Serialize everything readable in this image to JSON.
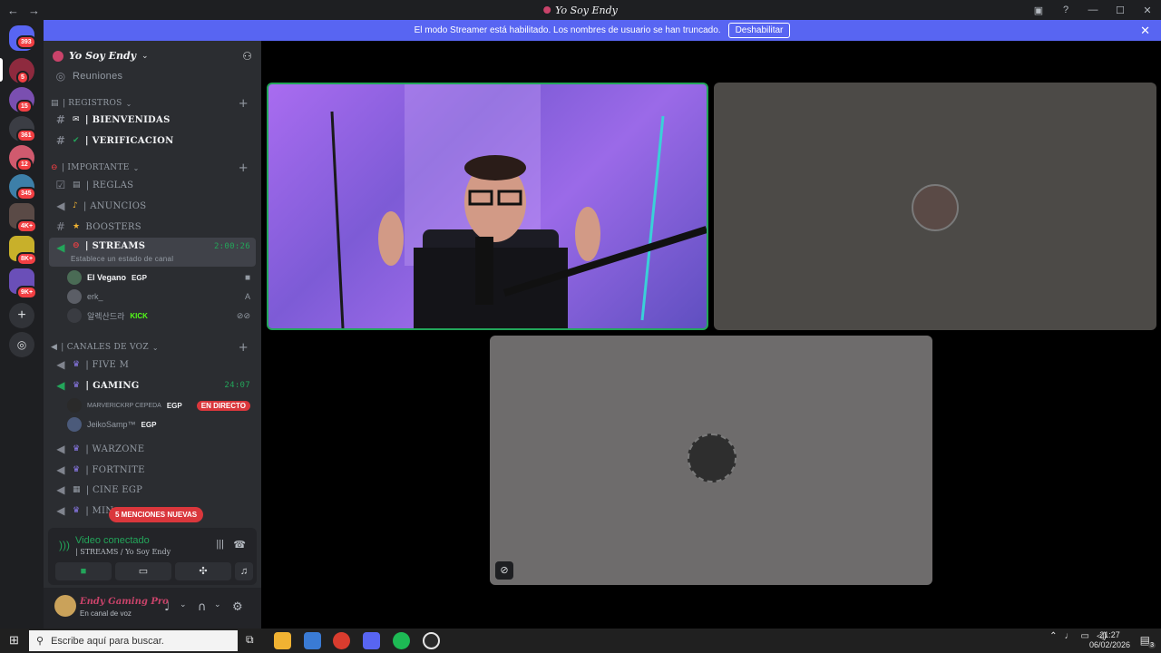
{
  "window": {
    "title": "Yo Soy Endy",
    "nav_back": "←",
    "nav_fwd": "→"
  },
  "banner": {
    "text": "El modo Streamer está habilitado. Los nombres de usuario se han truncado.",
    "button": "Deshabilitar"
  },
  "rail": {
    "badges": [
      "393",
      "5",
      "15",
      "361",
      "12",
      "345",
      "4K+",
      "8K+",
      "9K+"
    ]
  },
  "guild": {
    "name": "Yo Soy Endy",
    "meetings": "Reuniones"
  },
  "categories": {
    "registros": "| REGISTROS",
    "importante": "| IMPORTANTE",
    "voz": "| CANALES DE VOZ"
  },
  "channels": {
    "bienvenidas": "| BIENVENIDAS",
    "verificacion": "| VERIFICACION",
    "reglas": "| REGLAS",
    "anuncios": "| ANUNCIOS",
    "boosters": "BOOSTERS",
    "streams": "| STREAMS",
    "streams_time": "2:00:26",
    "streams_status": "Establece un estado de canal",
    "fivem": "| FIVE M",
    "gaming": "|  GAMING",
    "gaming_time": "24:07",
    "warzone": "| WARZONE",
    "fortnite": "| FORTNITE",
    "cine": "| CINE EGP",
    "mine": "| MIN"
  },
  "voice_users": {
    "streams": [
      {
        "name": "El Vegano",
        "tag": "EGP"
      },
      {
        "name": "erk_",
        "tag": ""
      },
      {
        "name": "알렉산드라",
        "tag": "KICK"
      }
    ],
    "gaming": [
      {
        "name": "MARVERICKRP CEPEDA",
        "tag": "EGP",
        "live": "EN DIRECTO"
      },
      {
        "name": "JeikoSamp™",
        "tag": "EGP"
      }
    ]
  },
  "mentions_pill": "5 MENCIONES NUEVAS",
  "voice_panel": {
    "title": "Video conectado",
    "subtitle": "| STREAMS / Yo Soy Endy"
  },
  "user_panel": {
    "name": "Endy Gaming Pro",
    "status": "En canal de voz"
  },
  "taskbar": {
    "search_placeholder": "Escribe aquí para buscar.",
    "time": "21:27",
    "date": "06/02/2026",
    "notif_count": "3"
  },
  "colors": {
    "accent": "#5865f2",
    "online": "#23a55a",
    "danger": "#da373c",
    "brand_pink": "#c9436a"
  }
}
